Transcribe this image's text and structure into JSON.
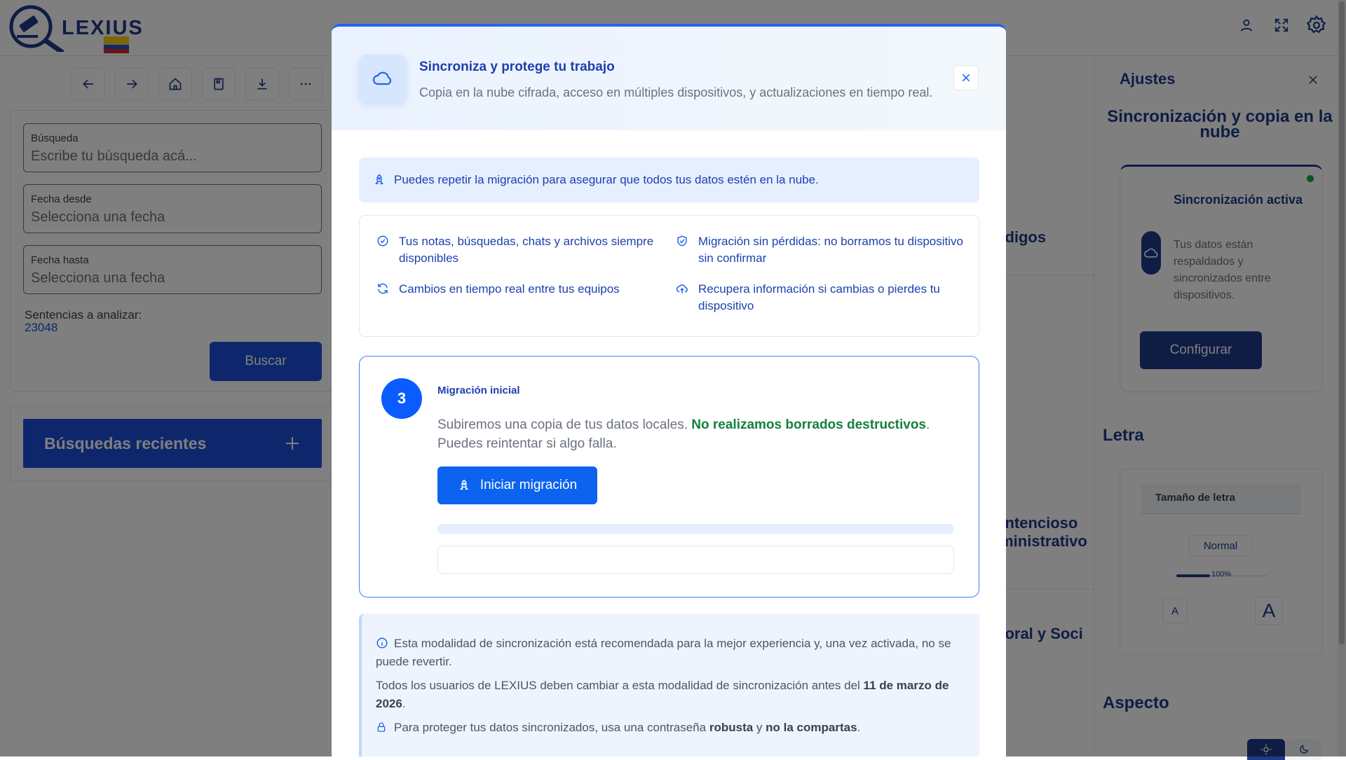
{
  "app": {
    "logo_text": "LEXIUS"
  },
  "search": {
    "busqueda_label": "Búsqueda",
    "busqueda_placeholder": "Escribe tu búsqueda acá...",
    "fecha_desde_label": "Fecha desde",
    "fecha_desde_placeholder": "Selecciona una fecha",
    "fecha_hasta_label": "Fecha hasta",
    "fecha_hasta_placeholder": "Selecciona una fecha",
    "sentencias_label": "Sentencias a analizar:",
    "sentencias_value": "23048",
    "buscar_button": "Buscar",
    "recientes_title": "Búsquedas recientes"
  },
  "background_list": {
    "items": [
      "odigos",
      "ontencioso",
      "lministrativo",
      "boral y Soci"
    ]
  },
  "settings": {
    "title": "Ajustes",
    "sync_section": "Sincronización y copia en la nube",
    "sync_status_title": "Sincronización activa",
    "sync_status_text": "Tus datos están respaldados y sincronizados entre dispositivos.",
    "configure_button": "Configurar",
    "letra_title": "Letra",
    "font_size_label": "Tamaño de letra",
    "font_size_value": "Normal",
    "font_size_percent": "100%",
    "font_small": "A",
    "font_large": "A",
    "aspecto_title": "Aspecto"
  },
  "modal": {
    "title": "Sincroniza y protege tu trabajo",
    "subtitle": "Copia en la nube cifrada, acceso en múltiples dispositivos, y actualizaciones en tiempo real.",
    "tip": "Puedes repetir la migración para asegurar que todos tus datos estén en la nube.",
    "features": [
      {
        "icon": "check-circle-icon",
        "text": "Tus notas, búsquedas, chats y archivos siempre disponibles"
      },
      {
        "icon": "shield-check-icon",
        "text": "Migración sin pérdidas: no borramos tu dispositivo sin confirmar"
      },
      {
        "icon": "refresh-icon",
        "text": "Cambios en tiempo real entre tus equipos"
      },
      {
        "icon": "cloud-upload-icon",
        "text": "Recupera información si cambias o pierdes tu dispositivo"
      }
    ],
    "step_number": "3",
    "step_title": "Migración inicial",
    "step_desc_1": "Subiremos una copia de tus datos locales.",
    "step_desc_highlight": "No realizamos borrados destructivos",
    "step_desc_2": "Puedes reintentar si algo falla.",
    "start_button": "Iniciar migración",
    "progress_fraction": 0,
    "info_1": "Esta modalidad de sincronización está recomendada para la mejor experiencia y, una vez activada, no se puede revertir.",
    "info_2_pre": "Todos los usuarios de LEXIUS deben cambiar a esta modalidad de sincronización antes del",
    "info_2_date": "11 de marzo de 2026",
    "info_3_pre": "Para proteger tus datos sincronizados, usa una contraseña",
    "info_3_b1": "robusta",
    "info_3_mid": "y",
    "info_3_b2": "no la compartas"
  },
  "colors": {
    "brand": "#1e3a8a",
    "primary": "#2563eb",
    "success": "#15803d"
  }
}
